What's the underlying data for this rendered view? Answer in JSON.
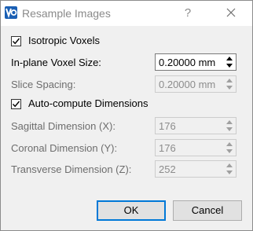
{
  "window": {
    "title": "Resample Images",
    "help_label": "?",
    "app_icon": "app-logo-icon",
    "close_icon": "close-icon"
  },
  "isotropic": {
    "label": "Isotropic Voxels",
    "checked": true
  },
  "inplane": {
    "label": "In-plane Voxel Size:",
    "value": "0.20000 mm",
    "enabled": true
  },
  "slice": {
    "label": "Slice Spacing:",
    "value": "0.20000 mm",
    "enabled": false
  },
  "autocompute": {
    "label": "Auto-compute Dimensions",
    "checked": true
  },
  "sagittal": {
    "label": "Sagittal Dimension (X):",
    "value": "176",
    "enabled": false
  },
  "coronal": {
    "label": "Coronal Dimension (Y):",
    "value": "176",
    "enabled": false
  },
  "transverse": {
    "label": "Transverse Dimension (Z):",
    "value": "252",
    "enabled": false
  },
  "buttons": {
    "ok": "OK",
    "cancel": "Cancel"
  },
  "colors": {
    "focus_border": "#0078d7",
    "disabled_text": "#8c8c8c"
  }
}
